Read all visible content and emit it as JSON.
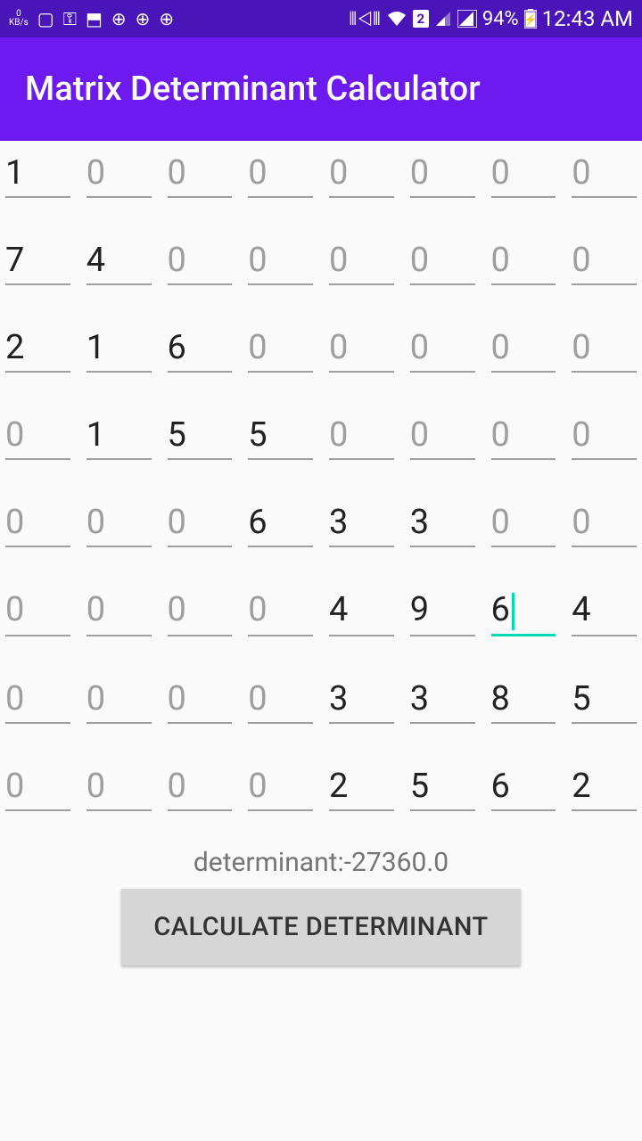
{
  "status_bar": {
    "kbs_value": "0",
    "kbs_unit": "KB/s",
    "battery": "94%",
    "time": "12:43 AM",
    "sim": "2"
  },
  "app_bar": {
    "title": "Matrix Determinant Calculator"
  },
  "matrix": {
    "placeholder": "0",
    "rows": [
      [
        "1",
        "",
        "",
        "",
        "",
        "",
        "",
        ""
      ],
      [
        "7",
        "4",
        "",
        "",
        "",
        "",
        "",
        ""
      ],
      [
        "2",
        "1",
        "6",
        "",
        "",
        "",
        "",
        ""
      ],
      [
        "",
        "1",
        "5",
        "5",
        "",
        "",
        "",
        ""
      ],
      [
        "",
        "",
        "",
        "6",
        "3",
        "3",
        "",
        ""
      ],
      [
        "",
        "",
        "",
        "",
        "4",
        "9",
        "6",
        "4"
      ],
      [
        "",
        "",
        "",
        "",
        "3",
        "3",
        "8",
        "5"
      ],
      [
        "",
        "",
        "",
        "",
        "2",
        "5",
        "6",
        "2"
      ]
    ],
    "focused_cell": [
      5,
      6
    ]
  },
  "result": {
    "label": "determinant:",
    "value": "-27360.0"
  },
  "button": {
    "label": "CALCULATE DETERMINANT"
  }
}
